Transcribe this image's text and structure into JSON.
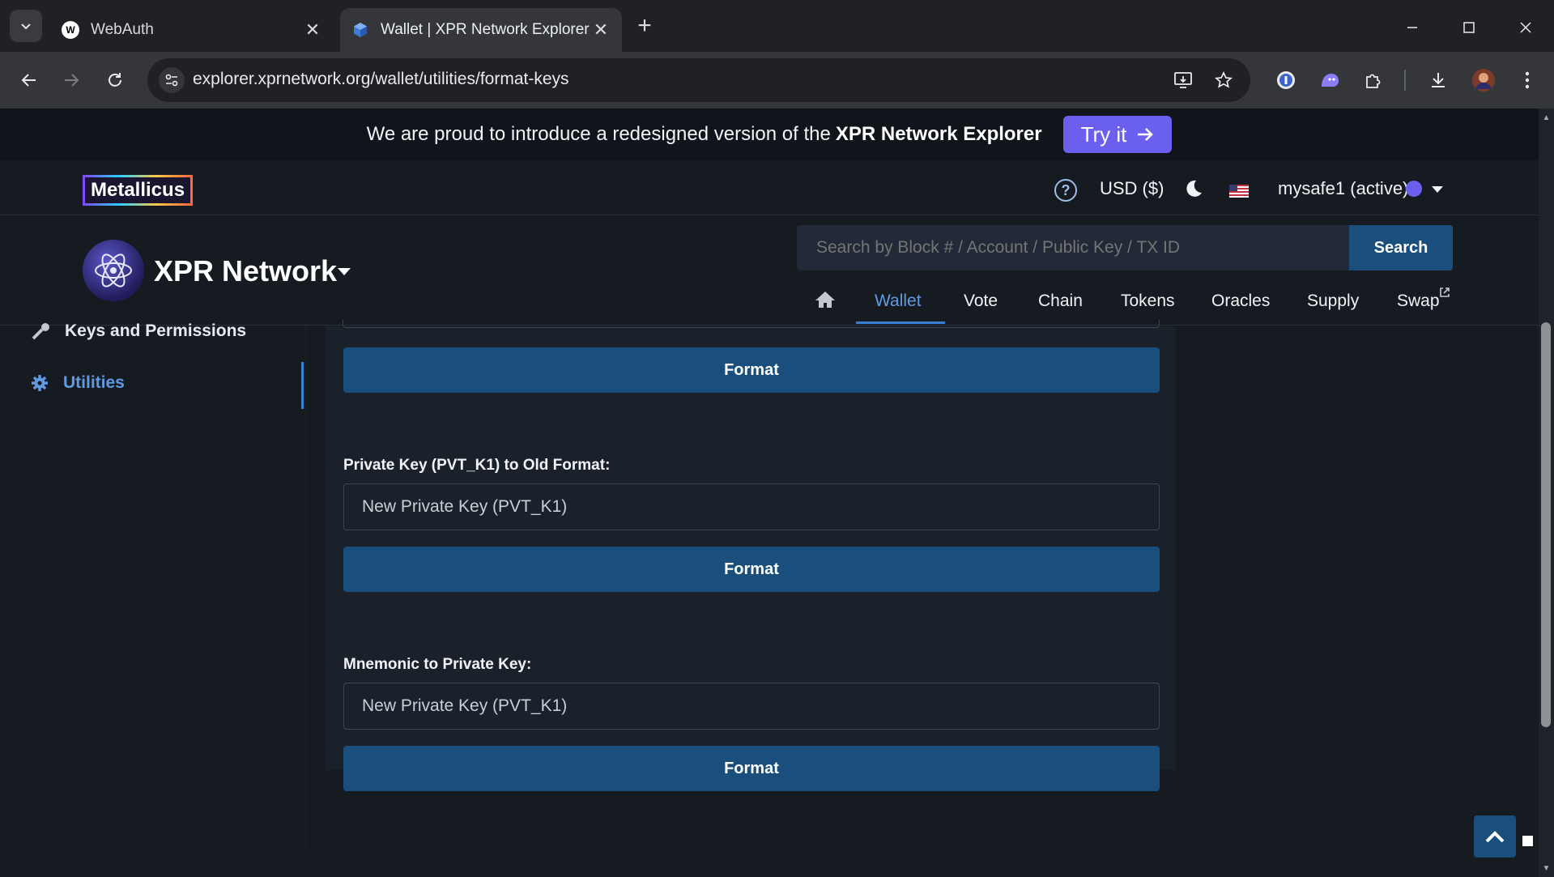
{
  "browser": {
    "tabs": [
      {
        "title": "WebAuth",
        "favicon": "W"
      },
      {
        "title": "Wallet | XPR Network Explorer",
        "favicon": "xpr-cube-icon"
      }
    ],
    "url": "explorer.xprnetwork.org/wallet/utilities/format-keys"
  },
  "banner": {
    "text": "We are proud to introduce a redesigned version of the",
    "strong": "XPR Network Explorer",
    "try_label": "Try it"
  },
  "topbar": {
    "brand": "Metallicus",
    "currency": "USD ($)",
    "account": "mysafe1 (active)"
  },
  "navbar": {
    "logo": "XPR Network",
    "search_placeholder": "Search by Block # / Account / Public Key / TX ID",
    "search_label": "Search",
    "items": [
      "Wallet",
      "Vote",
      "Chain",
      "Tokens",
      "Oracles",
      "Supply",
      "Swap"
    ]
  },
  "sidebar": {
    "items": [
      "Keys and Permissions",
      "Utilities"
    ]
  },
  "form": {
    "format_label": "Format",
    "private_to_old_label": "Private Key (PVT_K1) to Old Format:",
    "private_to_old_placeholder": "New Private Key (PVT_K1)",
    "mnemonic_label": "Mnemonic to Private Key:",
    "mnemonic_placeholder": "New Private Key (PVT_K1)"
  },
  "colors": {
    "accent": "#1a4f7d",
    "active_link": "#5f9be2",
    "try_button": "#6b5ff0"
  }
}
